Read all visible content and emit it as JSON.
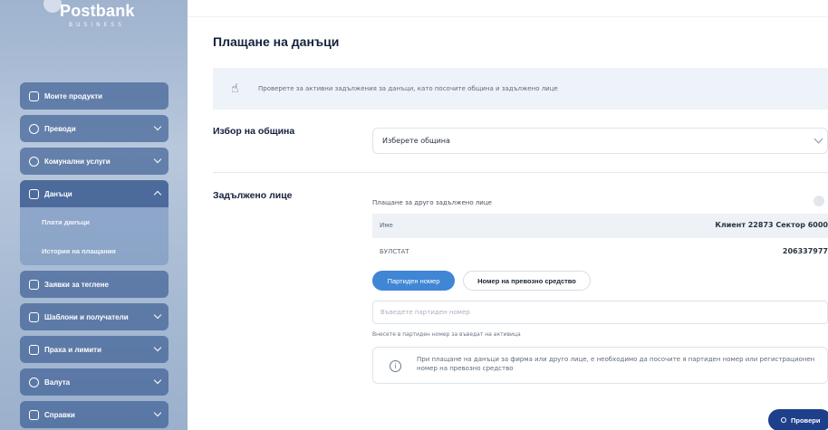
{
  "brand": {
    "name": "Postbank",
    "sub": "BUSINESS"
  },
  "sidebar": {
    "items": [
      {
        "label": "Моите продукти",
        "icon": "wallet-icon"
      },
      {
        "label": "Преводи",
        "icon": "transfer-icon"
      },
      {
        "label": "Комунални услуги",
        "icon": "bulb-icon"
      },
      {
        "label": "Данъци",
        "icon": "document-icon"
      },
      {
        "label": "Заявки за теглене",
        "icon": "bank-icon"
      },
      {
        "label": "Шаблони и получатели",
        "icon": "template-icon"
      },
      {
        "label": "Праха и лимити",
        "icon": "limits-icon"
      },
      {
        "label": "Валута",
        "icon": "currency-icon"
      },
      {
        "label": "Справки",
        "icon": "report-icon"
      }
    ],
    "taxes_sub": [
      {
        "label": "Плати данъци"
      },
      {
        "label": "История на плащания"
      }
    ]
  },
  "main": {
    "title": "Плащане на данъци",
    "info": "Проверете за активни задължения за данъци, като посочите община и задължено лице",
    "municipality": {
      "label": "Избор на община",
      "select_value": "Изберете община"
    },
    "obligor": {
      "label": "Задължено лице",
      "other_toggle_label": "Плащане за друго задължено лице",
      "rows": [
        {
          "label": "Име",
          "value": "Клиент 22873 Сектор 6000"
        },
        {
          "label": "БУЛСТАТ",
          "value": "206337977"
        }
      ],
      "tabs": [
        {
          "label": "Партиден номер"
        },
        {
          "label": "Номер на превозно средство"
        }
      ],
      "input_placeholder": "Въведете партиден номер",
      "hint": "Внесете в партиден номер за въведат на активица",
      "note": "При плащане на данъци за фирма или друго лице, е необходимо да посочите я партиден номер или регистрационен номер на превозно средство"
    },
    "check_button": "Провери"
  }
}
